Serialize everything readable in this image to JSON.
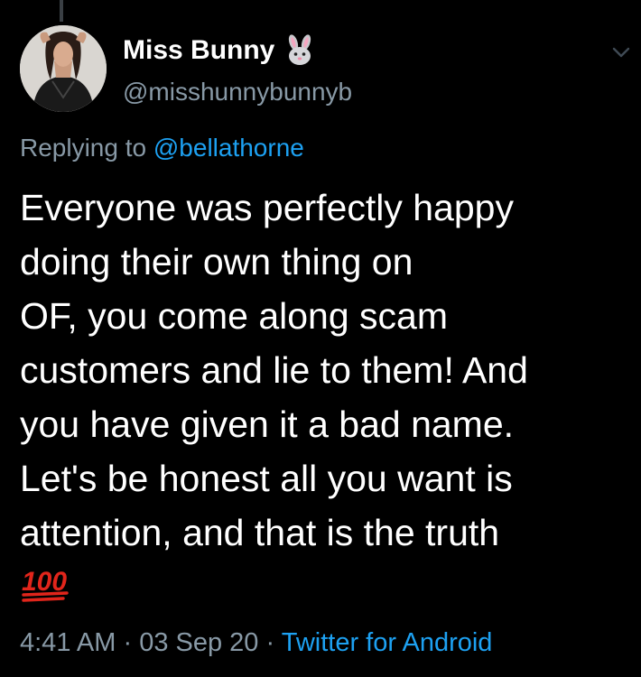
{
  "tweet": {
    "display_name": "Miss Bunny",
    "name_emoji": "rabbit-face-icon",
    "handle": "@misshunnybunnyb",
    "reply_prefix": "Replying to",
    "reply_to": "@bellathorne",
    "text": "Everyone was perfectly happy\ndoing their own thing on\nOF, you come along scam\ncustomers and lie to them! And\nyou have given it a bad name.\nLet's be honest all you want is\nattention, and that is the truth",
    "text_emoji": "hundred-points-icon",
    "time": "4:41 AM",
    "separator": "·",
    "date": "03 Sep 20",
    "source": "Twitter for Android"
  },
  "colors": {
    "background": "#000000",
    "primary_text": "#ffffff",
    "secondary_text": "#8899a6",
    "link": "#1da1f2",
    "emoji_red": "#e1251b"
  }
}
